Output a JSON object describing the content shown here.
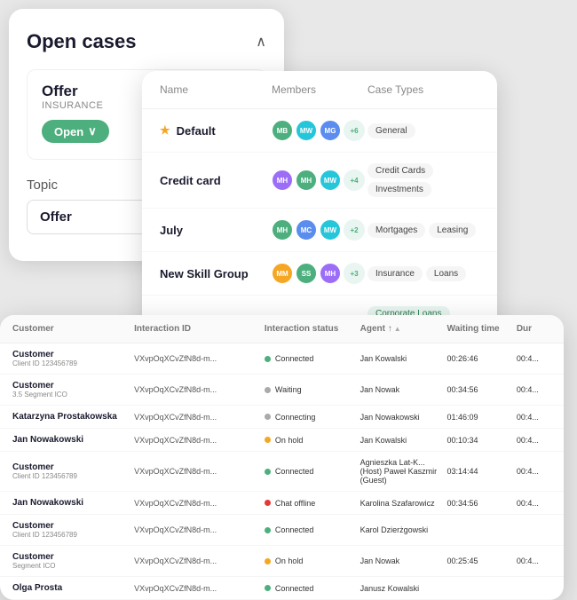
{
  "backCard": {
    "title": "Open cases",
    "chevron": "∧",
    "offer": {
      "label": "Offer",
      "sublabel": "INSURANCE",
      "statusBadge": "Open",
      "statusChevron": "∨"
    },
    "topic": {
      "label": "Topic",
      "value": "Offer",
      "arrow": "∨"
    }
  },
  "midCard": {
    "columns": [
      "Name",
      "Members",
      "Case Types"
    ],
    "rows": [
      {
        "name": "Default",
        "star": true,
        "members": [
          "MB",
          "MW",
          "MG"
        ],
        "memberColors": [
          "green",
          "teal",
          "blue"
        ],
        "plusCount": "+6",
        "caseTypes": [
          "General"
        ]
      },
      {
        "name": "Credit card",
        "star": false,
        "members": [
          "MH",
          "MH",
          "MW"
        ],
        "memberColors": [
          "purple",
          "green",
          "teal"
        ],
        "plusCount": "+4",
        "caseTypes": [
          "Credit Cards",
          "Investments"
        ]
      },
      {
        "name": "July",
        "star": false,
        "members": [
          "MH",
          "MC",
          "MW"
        ],
        "memberColors": [
          "green",
          "blue",
          "teal"
        ],
        "plusCount": "+2",
        "caseTypes": [
          "Mortgages",
          "Leasing"
        ]
      },
      {
        "name": "New Skill Group",
        "star": false,
        "members": [
          "MM",
          "SS",
          "MH"
        ],
        "memberColors": [
          "orange",
          "green",
          "purple"
        ],
        "plusCount": "+3",
        "caseTypes": [
          "Insurance",
          "Loans"
        ]
      }
    ],
    "corporateLoanTag": "Corporate Loans"
  },
  "frontCard": {
    "columns": [
      "Customer",
      "Interaction ID",
      "Interaction status",
      "Agent ↑",
      "Waiting time",
      "Dur"
    ],
    "rows": [
      {
        "customerName": "Customer",
        "customerSub": "Client ID 123456789",
        "interactionId": "VXvpOqXCvZfN8d-m...",
        "status": "Connected",
        "statusColor": "green",
        "agent": "Jan Kowalski",
        "waitingTime": "00:26:46",
        "duration": "00:4..."
      },
      {
        "customerName": "Customer",
        "customerSub": "3.5 Segment ICO",
        "interactionId": "VXvpOqXCvZfN8d-m...",
        "status": "Waiting",
        "statusColor": "gray",
        "agent": "Jan Nowak",
        "waitingTime": "00:34:56",
        "duration": "00:4..."
      },
      {
        "customerName": "Katarzyna Prostakowska",
        "customerSub": "",
        "interactionId": "VXvpOqXCvZfN8d-m...",
        "status": "Connecting",
        "statusColor": "gray",
        "agent": "Jan Nowakowski",
        "waitingTime": "01:46:09",
        "duration": "00:4..."
      },
      {
        "customerName": "Jan Nowakowski",
        "customerSub": "",
        "interactionId": "VXvpOqXCvZfN8d-m...",
        "status": "On hold",
        "statusColor": "orange",
        "agent": "Jan Kowalski",
        "waitingTime": "00:10:34",
        "duration": "00:4..."
      },
      {
        "customerName": "Customer",
        "customerSub": "Client ID 123456789",
        "interactionId": "VXvpOqXCvZfN8d-m...",
        "status": "Connected",
        "statusColor": "green",
        "agent": "Agnieszka Lat-K... (Host) Paweł Kaszmir (Guest)",
        "waitingTime": "03:14:44",
        "duration": "00:4..."
      },
      {
        "customerName": "Jan Nowakowski",
        "customerSub": "",
        "interactionId": "VXvpOqXCvZfN8d-m...",
        "status": "Chat offline",
        "statusColor": "red",
        "agent": "Karolina Szafarowicz",
        "waitingTime": "00:34:56",
        "duration": "00:4..."
      },
      {
        "customerName": "Customer",
        "customerSub": "Client ID 123456789",
        "interactionId": "VXvpOqXCvZfN8d-m...",
        "status": "Connected",
        "statusColor": "green",
        "agent": "Karol Dzierżgowski",
        "waitingTime": "",
        "duration": ""
      },
      {
        "customerName": "Customer",
        "customerSub": "Segment ICO",
        "interactionId": "VXvpOqXCvZfN8d-m...",
        "status": "On hold",
        "statusColor": "orange",
        "agent": "Jan Nowak",
        "waitingTime": "00:25:45",
        "duration": "00:4..."
      },
      {
        "customerName": "Olga Prosta",
        "customerSub": "",
        "interactionId": "VXvpOqXCvZfN8d-m...",
        "status": "Connected",
        "statusColor": "green",
        "agent": "Janusz Kowalski",
        "waitingTime": "",
        "duration": ""
      }
    ]
  }
}
